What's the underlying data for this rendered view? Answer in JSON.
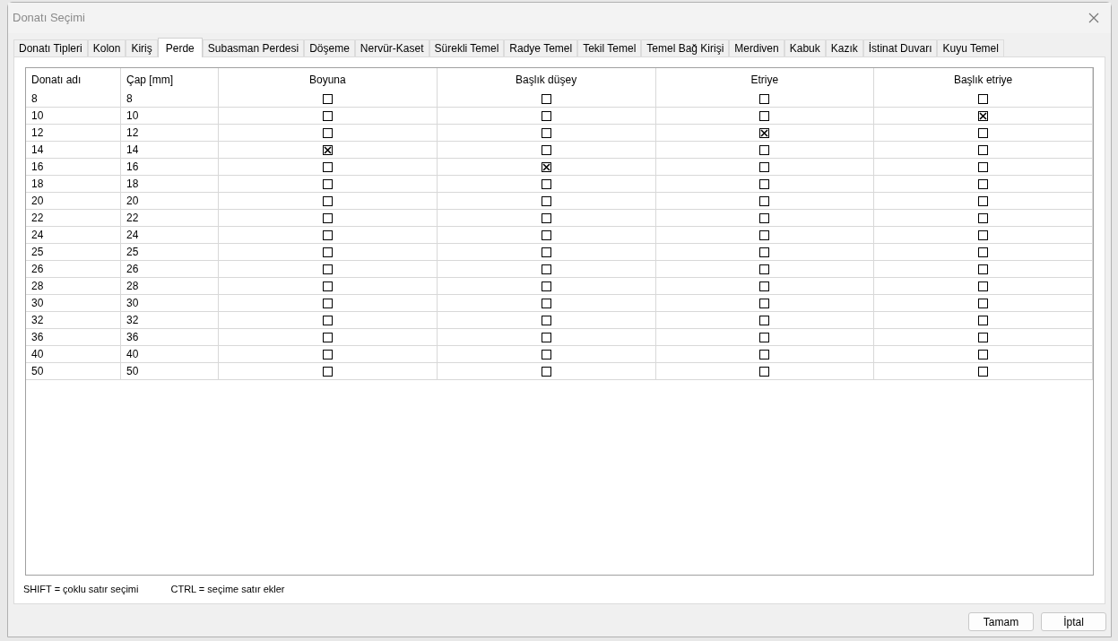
{
  "window": {
    "title": "Donatı Seçimi"
  },
  "tabs": [
    {
      "label": "Donatı Tipleri",
      "selected": false
    },
    {
      "label": "Kolon",
      "selected": false
    },
    {
      "label": "Kiriş",
      "selected": false
    },
    {
      "label": "Perde",
      "selected": true
    },
    {
      "label": "Subasman Perdesi",
      "selected": false
    },
    {
      "label": "Döşeme",
      "selected": false
    },
    {
      "label": "Nervür-Kaset",
      "selected": false
    },
    {
      "label": "Sürekli Temel",
      "selected": false
    },
    {
      "label": "Radye Temel",
      "selected": false
    },
    {
      "label": "Tekil Temel",
      "selected": false
    },
    {
      "label": "Temel Bağ Kirişi",
      "selected": false
    },
    {
      "label": "Merdiven",
      "selected": false
    },
    {
      "label": "Kabuk",
      "selected": false
    },
    {
      "label": "Kazık",
      "selected": false
    },
    {
      "label": "İstinat Duvarı",
      "selected": false
    },
    {
      "label": "Kuyu Temel",
      "selected": false
    }
  ],
  "table": {
    "columns": [
      "Donatı adı",
      "Çap [mm]",
      "Boyuna",
      "Başlık düşey",
      "Etriye",
      "Başlık etriye"
    ],
    "rows": [
      {
        "name": "8",
        "diameter": "8",
        "checks": [
          false,
          false,
          false,
          false
        ]
      },
      {
        "name": "10",
        "diameter": "10",
        "checks": [
          false,
          false,
          false,
          true
        ]
      },
      {
        "name": "12",
        "diameter": "12",
        "checks": [
          false,
          false,
          true,
          false
        ]
      },
      {
        "name": "14",
        "diameter": "14",
        "checks": [
          true,
          false,
          false,
          false
        ]
      },
      {
        "name": "16",
        "diameter": "16",
        "checks": [
          false,
          true,
          false,
          false
        ]
      },
      {
        "name": "18",
        "diameter": "18",
        "checks": [
          false,
          false,
          false,
          false
        ]
      },
      {
        "name": "20",
        "diameter": "20",
        "checks": [
          false,
          false,
          false,
          false
        ]
      },
      {
        "name": "22",
        "diameter": "22",
        "checks": [
          false,
          false,
          false,
          false
        ]
      },
      {
        "name": "24",
        "diameter": "24",
        "checks": [
          false,
          false,
          false,
          false
        ]
      },
      {
        "name": "25",
        "diameter": "25",
        "checks": [
          false,
          false,
          false,
          false
        ]
      },
      {
        "name": "26",
        "diameter": "26",
        "checks": [
          false,
          false,
          false,
          false
        ]
      },
      {
        "name": "28",
        "diameter": "28",
        "checks": [
          false,
          false,
          false,
          false
        ]
      },
      {
        "name": "30",
        "diameter": "30",
        "checks": [
          false,
          false,
          false,
          false
        ]
      },
      {
        "name": "32",
        "diameter": "32",
        "checks": [
          false,
          false,
          false,
          false
        ]
      },
      {
        "name": "36",
        "diameter": "36",
        "checks": [
          false,
          false,
          false,
          false
        ]
      },
      {
        "name": "40",
        "diameter": "40",
        "checks": [
          false,
          false,
          false,
          false
        ]
      },
      {
        "name": "50",
        "diameter": "50",
        "checks": [
          false,
          false,
          false,
          false
        ]
      }
    ]
  },
  "hints": [
    "SHIFT = çoklu satır seçimi",
    "CTRL = seçime satır ekler"
  ],
  "buttons": [
    "Tamam",
    "İptal"
  ]
}
